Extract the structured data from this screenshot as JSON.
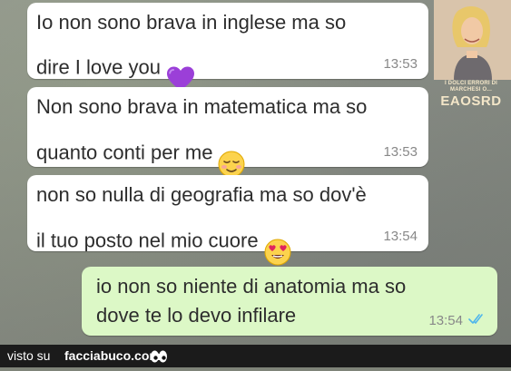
{
  "colors": {
    "incoming_bubble": "#ffffff",
    "outgoing_bubble": "#dcf8c6",
    "read_ticks": "#4fb6ec",
    "footer_bar": "#1b1b1b"
  },
  "messages": [
    {
      "text": "Io non sono brava in inglese ma so\ndire I love you",
      "time": "13:53",
      "emoji": "purple-heart-icon",
      "direction": "incoming"
    },
    {
      "text": "Non sono brava in matematica ma so\nquanto conti per me",
      "time": "13:53",
      "emoji": "relieved-face-icon",
      "direction": "incoming"
    },
    {
      "text": "non so nulla di geografia ma so dov'è\nil tuo posto nel mio cuore",
      "time": "13:54",
      "emoji": "heart-eyes-face-icon",
      "direction": "incoming"
    },
    {
      "text": "io non so niente di anatomia ma so\ndove te lo devo infilare",
      "time": "13:54",
      "status": "double-check-read-icon",
      "direction": "outgoing"
    }
  ],
  "watermark": {
    "small_text": "I DOLCI ERRORI DI MARCHESI O...",
    "brand": "EAOSRD"
  },
  "footer": {
    "visto_su": "visto su",
    "site": "facciabuco.com",
    "logo_icon": "eyes-icon"
  }
}
